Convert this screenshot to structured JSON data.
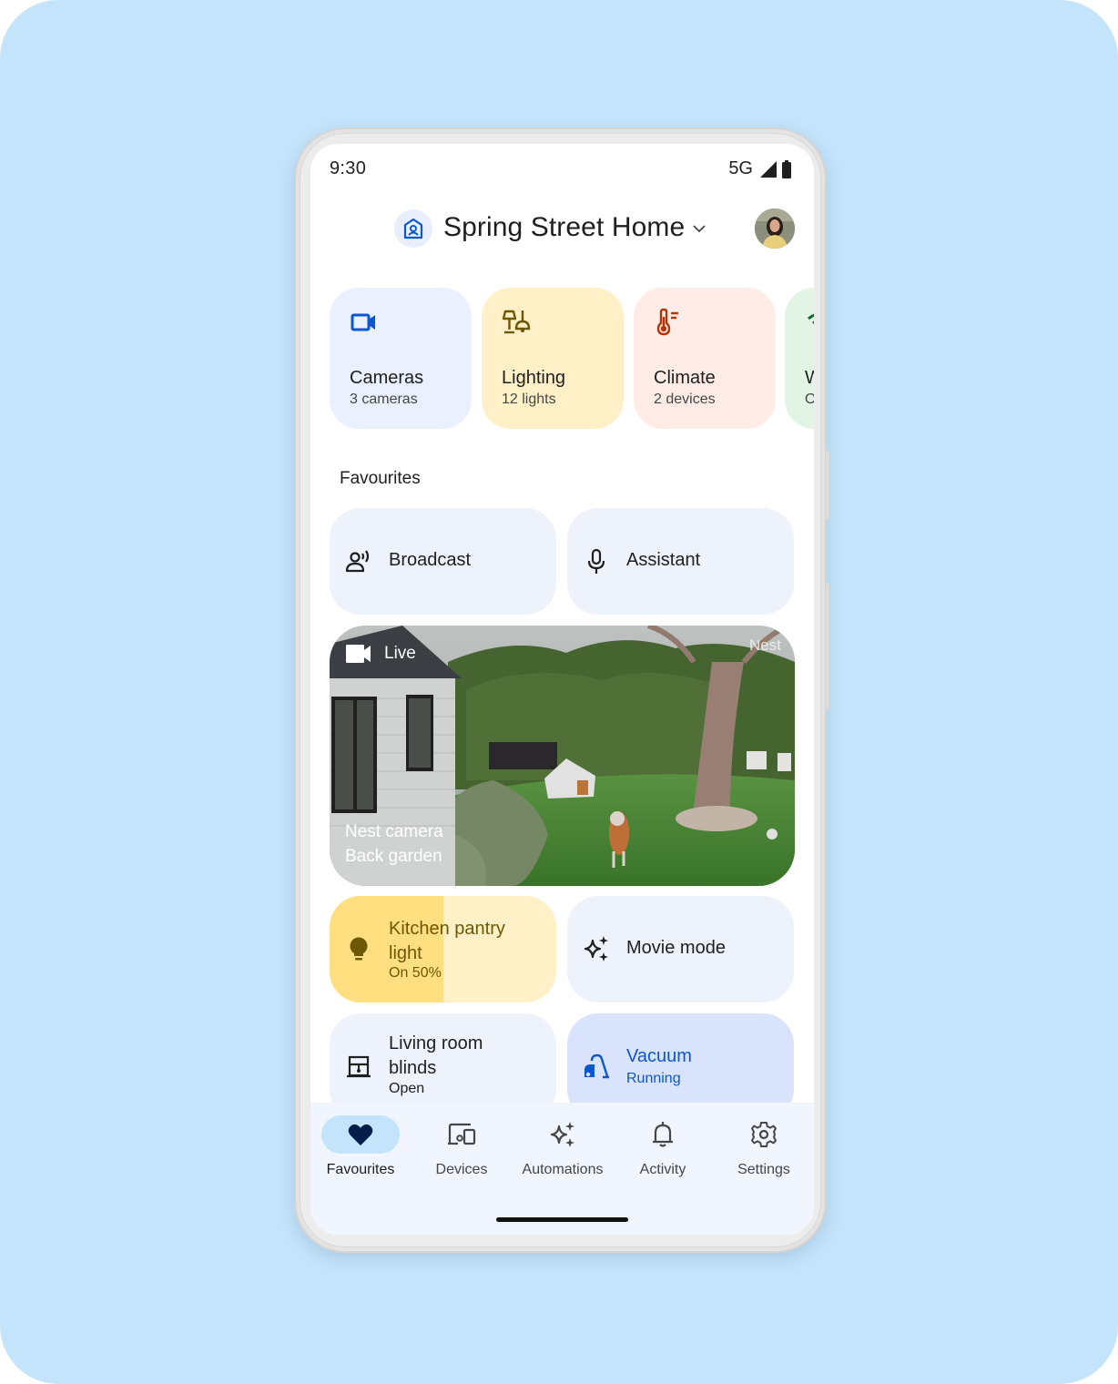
{
  "status_bar": {
    "time": "9:30",
    "network": "5G",
    "signal_icon": "cell-signal-icon",
    "battery_icon": "battery-icon"
  },
  "header": {
    "home_icon": "home-camera-icon",
    "home_name": "Spring Street Home",
    "dropdown_icon": "chevron-down-icon",
    "avatar": "user-avatar"
  },
  "categories": [
    {
      "title": "Cameras",
      "subtitle": "3 cameras",
      "icon": "videocam-icon",
      "color": "#0b57d0"
    },
    {
      "title": "Lighting",
      "subtitle": "12 lights",
      "icon": "lamp-icon",
      "color": "#6d5700"
    },
    {
      "title": "Climate",
      "subtitle": "2 devices",
      "icon": "thermostat-icon",
      "color": "#b3350b"
    },
    {
      "title": "W",
      "subtitle": "O",
      "icon": "wifi-icon",
      "color": "#146c2e"
    }
  ],
  "favourites": {
    "section_title": "Favourites",
    "broadcast": {
      "label": "Broadcast",
      "icon": "broadcast-icon"
    },
    "assistant": {
      "label": "Assistant",
      "icon": "mic-icon"
    },
    "camera": {
      "live_label": "Live",
      "brand": "Nest",
      "name": "Nest camera",
      "location": "Back garden"
    },
    "kitchen_light": {
      "label_line1": "Kitchen pantry",
      "label_line2": "light",
      "status": "On 50%",
      "brightness": 0.5,
      "icon": "lightbulb-icon"
    },
    "movie_mode": {
      "label": "Movie mode",
      "icon": "sparkle-icon"
    },
    "blinds": {
      "label_line1": "Living room",
      "label_line2": "blinds",
      "status": "Open",
      "icon": "blinds-icon"
    },
    "vacuum": {
      "label": "Vacuum",
      "status": "Running",
      "icon": "vacuum-icon"
    }
  },
  "bottom_nav": {
    "items": [
      {
        "label": "Favourites",
        "icon": "heart-icon",
        "active": true
      },
      {
        "label": "Devices",
        "icon": "devices-icon",
        "active": false
      },
      {
        "label": "Automations",
        "icon": "sparkle-icon",
        "active": false
      },
      {
        "label": "Activity",
        "icon": "bell-icon",
        "active": false
      },
      {
        "label": "Settings",
        "icon": "gear-icon",
        "active": false
      }
    ]
  },
  "colors": {
    "accent_blue": "#0b57d0",
    "nav_active_pill": "#c3e4fb",
    "background": "#c4e4fb"
  }
}
